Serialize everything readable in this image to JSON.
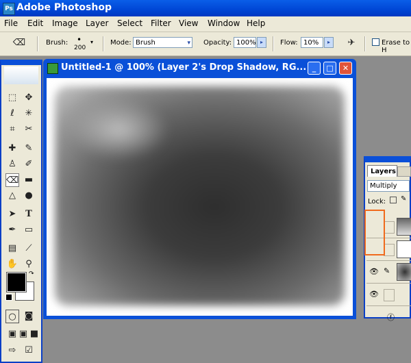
{
  "app": {
    "title": "Adobe Photoshop",
    "icon": "photoshop-icon"
  },
  "menu": [
    "File",
    "Edit",
    "Image",
    "Layer",
    "Select",
    "Filter",
    "View",
    "Window",
    "Help"
  ],
  "options": {
    "tool_icon": "eraser-icon",
    "brush_label": "Brush:",
    "brush_size": "200",
    "mode_label": "Mode:",
    "mode_value": "Brush",
    "opacity_label": "Opacity:",
    "opacity_value": "100%",
    "flow_label": "Flow:",
    "flow_value": "10%",
    "erase_history_label": "Erase to H"
  },
  "document": {
    "title": "Untitled-1 @ 100% (Layer 2's Drop Shadow, RG...",
    "buttons": {
      "minimize": "_",
      "maximize": "□",
      "close": "✕"
    }
  },
  "layers_panel": {
    "tab_label": "Layers",
    "blend_mode": "Multiply",
    "lock_label": "Lock:",
    "highlight_color": "#f06a1c"
  },
  "colors": {
    "titlebar": "#0a50d8",
    "foreground": "#000000",
    "background": "#ffffff"
  }
}
